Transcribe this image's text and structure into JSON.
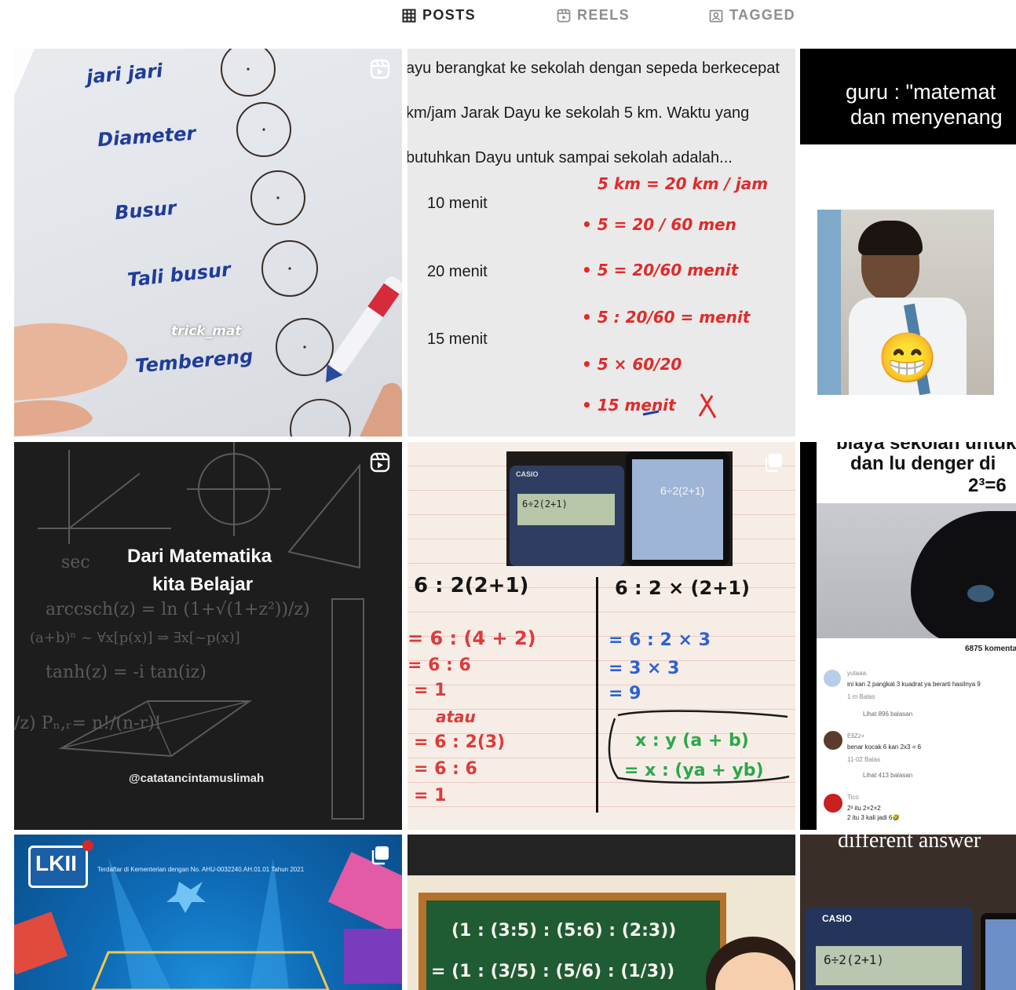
{
  "tabs": {
    "posts": {
      "label": "POSTS",
      "icon": "grid-icon"
    },
    "reels": {
      "label": "REELS",
      "icon": "reels-icon"
    },
    "tagged": {
      "label": "TAGGED",
      "icon": "tagged-icon"
    }
  },
  "posts": {
    "p1": {
      "type": "reel",
      "terms": [
        "jari jari",
        "Diameter",
        "Busur",
        "Tali busur",
        "Tembereng"
      ],
      "watermark": "trick_mat"
    },
    "p2": {
      "type": "image",
      "question": [
        "ayu berangkat ke sekolah dengan sepeda berkecepat",
        "km/jam Jarak Dayu ke sekolah 5 km. Waktu yang",
        "butuhkan Dayu untuk sampai sekolah adalah..."
      ],
      "options": [
        "10 menit",
        "20 menit",
        "15 menit"
      ],
      "work": [
        "5 km = 20 km / jam",
        "• 5 = 20 / 60 men",
        "• 5 = 20/60 menit",
        "• 5 : 20/60 = menit",
        "• 5 × 60/20",
        "• 15 menit"
      ]
    },
    "p3": {
      "type": "image",
      "caption": [
        "guru : \"matemat",
        "dan menyenang"
      ],
      "emoji": "😁"
    },
    "p4": {
      "type": "reel",
      "title": [
        "Dari Matematika",
        "kita Belajar"
      ],
      "watermark": "@catatancintamuslimah"
    },
    "p5": {
      "type": "carousel",
      "phone_display": "6÷2(2+1)",
      "calc_display": "6÷2(2+1)",
      "left_work": [
        "6 : 2(2+1)",
        "= 6 : (4 + 2)",
        "= 6 : 6",
        "= 1",
        "atau",
        "= 6 : 2(3)",
        "= 6 : 6",
        "= 1"
      ],
      "right_work": [
        "6 : 2 × (2+1)",
        "= 6 : 2 × 3",
        "= 3 × 3",
        "= 9",
        "x : y (a + b)",
        "= x : (ya + yb)"
      ]
    },
    "p6": {
      "type": "image",
      "caption": [
        "biaya sekolah untuk",
        "dan lu denger di",
        "2³=6"
      ],
      "comment_count": "6875 komentar",
      "comments": [
        {
          "user": "yutaaa.",
          "text": "ini kan 2 pangkat 3 kuadrat ya berarti hasilnya 9",
          "meta": "1 m   Balas",
          "replies": "Lihat 896 balasan"
        },
        {
          "user": "EllZz+",
          "text": "benar kocak 6 kan 2x3 = 6",
          "meta": "11-02   Balas",
          "replies": "Lihat 413 balasan"
        },
        {
          "user": "Tico",
          "text": "2³ itu 2×2×2",
          "text2": "2 itu 3 kali jadi 6🤣",
          "meta": "",
          "replies": ""
        }
      ]
    },
    "p7": {
      "type": "carousel",
      "logo": "LKII",
      "registration": "Terdaftar di Kementerian dengan No. AHU-0032240.AH.01.01 Tahun 2021"
    },
    "p8": {
      "type": "image",
      "board_line1": "(1 : (3:5) : (5:6) : (2:3))",
      "board_line2": "= (1 : (3/5) : (5/6) : (1/3))"
    },
    "p9": {
      "type": "image",
      "caption": "different answer",
      "calc_brand": "CASIO",
      "calc_display": "6÷2(2+1)"
    }
  },
  "colors": {
    "active_tab": "#262626",
    "inactive_tab": "#8e8e8e",
    "marker_red": "#e02a2a",
    "marker_blue": "#1d3aa8",
    "board_green": "#1f5b33"
  }
}
